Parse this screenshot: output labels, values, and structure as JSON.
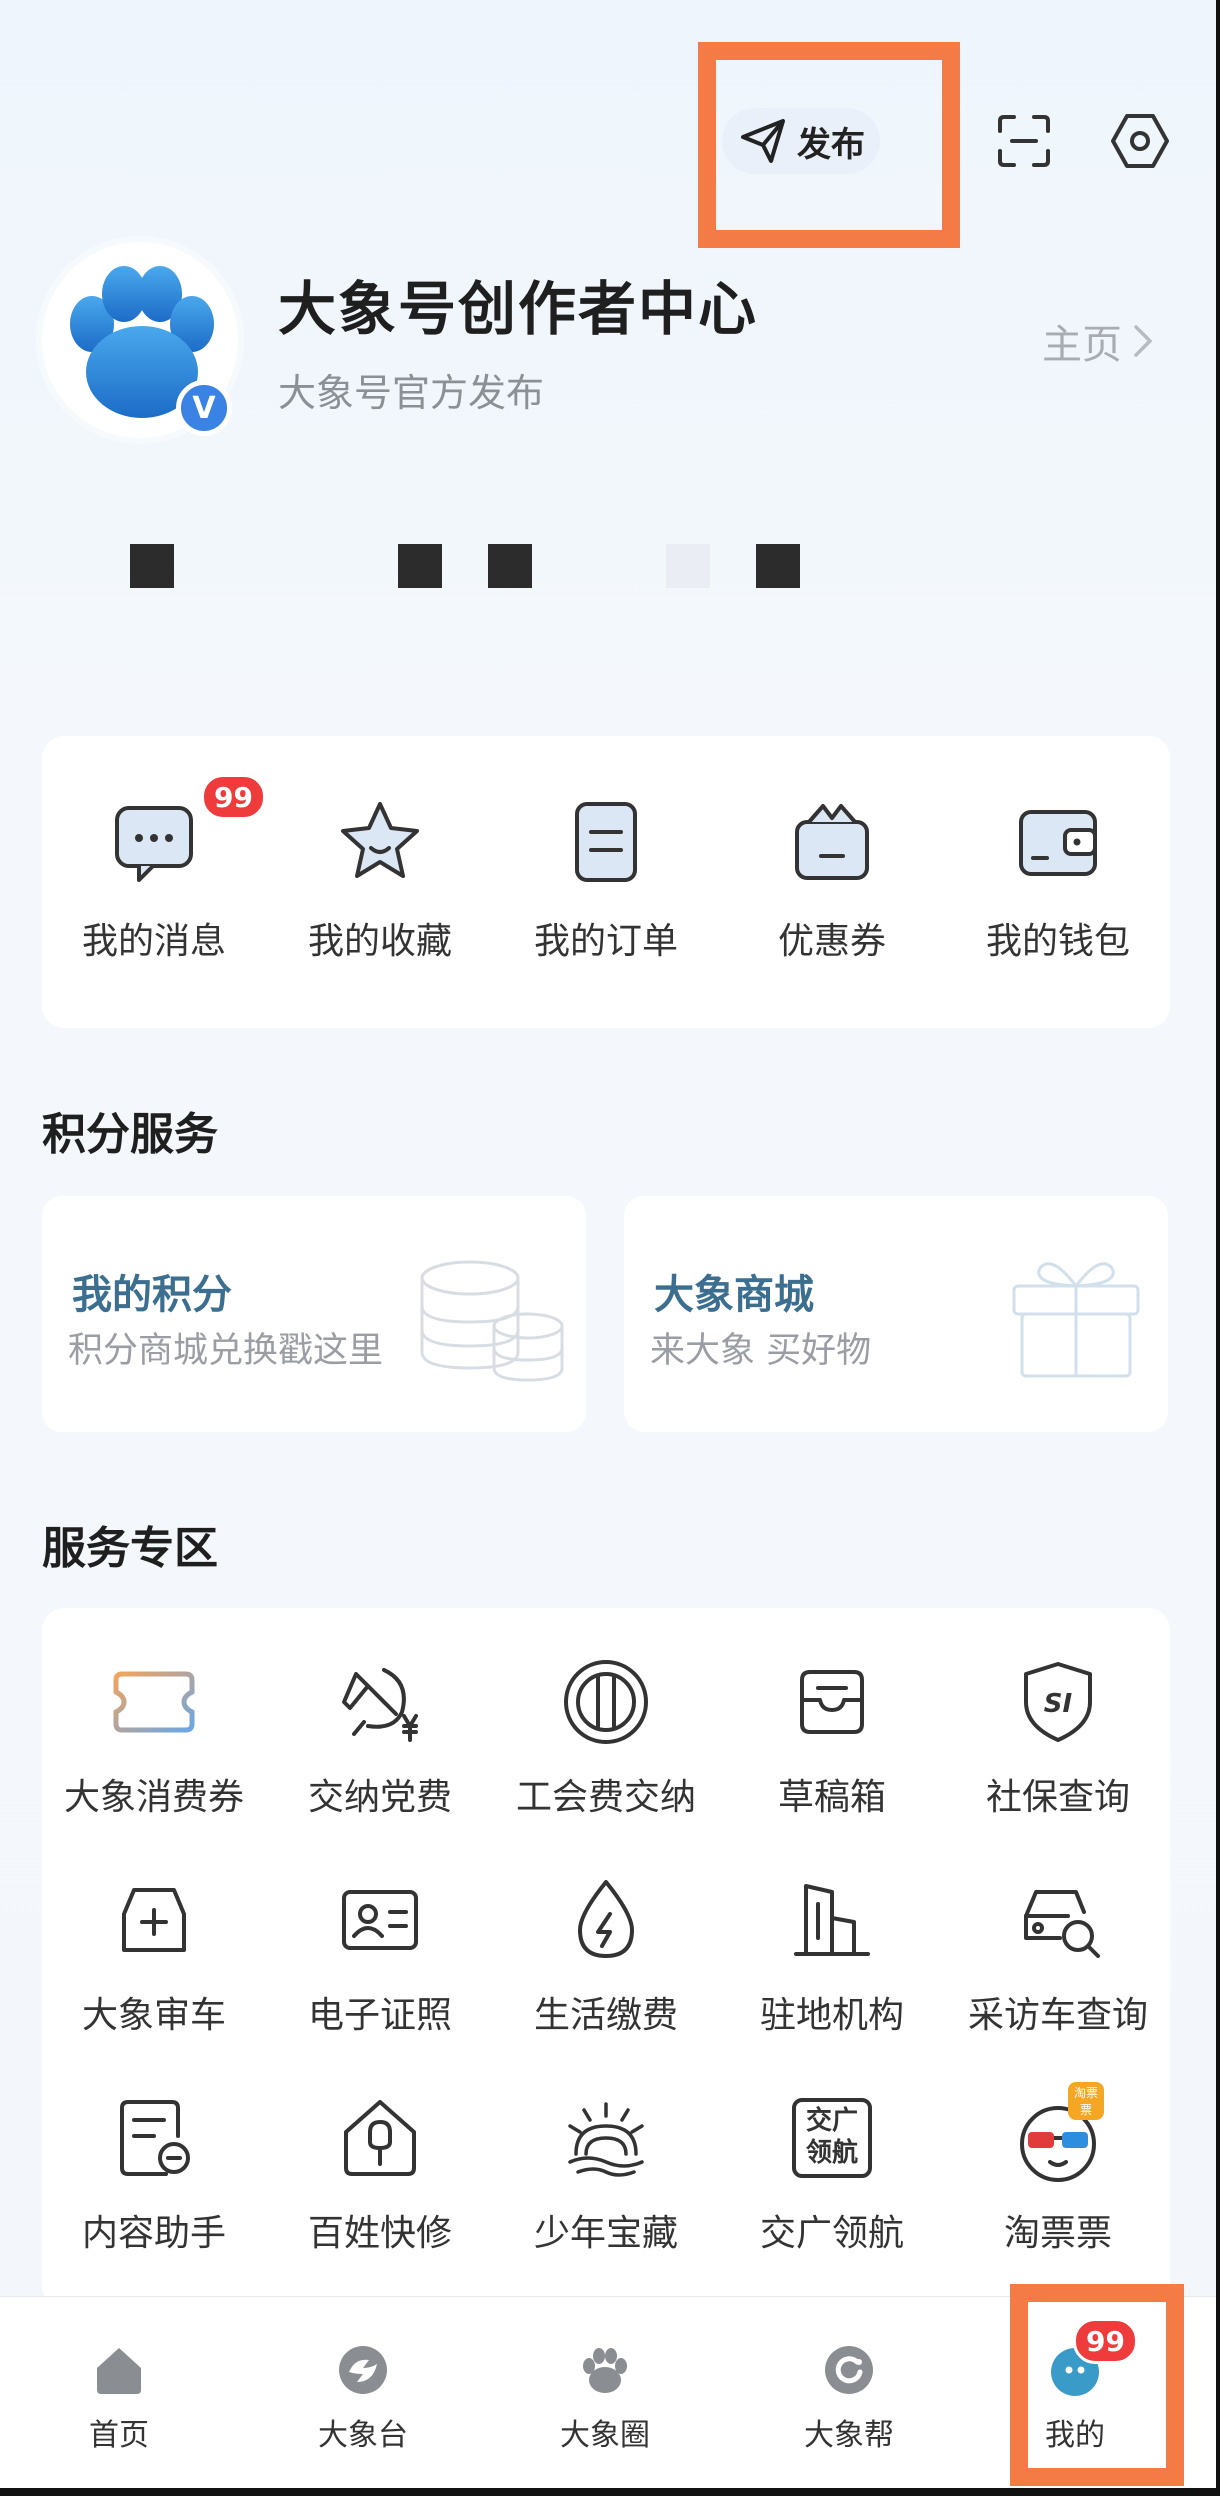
{
  "header": {
    "publish_label": "发布",
    "scan_icon": "scan-icon",
    "settings_icon": "settings-icon"
  },
  "profile": {
    "name": "大象号创作者中心",
    "subtitle": "大象号官方发布",
    "homepage_label": "主页",
    "verified_badge": "V"
  },
  "quick_actions": [
    {
      "label": "我的消息",
      "icon": "message-icon",
      "badge": "99"
    },
    {
      "label": "我的收藏",
      "icon": "star-icon"
    },
    {
      "label": "我的订单",
      "icon": "order-icon"
    },
    {
      "label": "优惠券",
      "icon": "coupon-icon"
    },
    {
      "label": "我的钱包",
      "icon": "wallet-icon"
    }
  ],
  "points_section": {
    "title": "积分服务",
    "cards": [
      {
        "title": "我的积分",
        "subtitle": "积分商城兑换戳这里",
        "icon": "coins-icon"
      },
      {
        "title": "大象商城",
        "subtitle": "来大象  买好物",
        "icon": "gift-icon"
      }
    ]
  },
  "services_section": {
    "title": "服务专区",
    "items": [
      {
        "label": "大象消费券",
        "icon": "ticket-icon"
      },
      {
        "label": "交纳党费",
        "icon": "party-fee-icon"
      },
      {
        "label": "工会费交纳",
        "icon": "union-icon"
      },
      {
        "label": "草稿箱",
        "icon": "draft-box-icon"
      },
      {
        "label": "社保查询",
        "icon": "social-security-icon"
      },
      {
        "label": "大象审车",
        "icon": "car-inspection-icon"
      },
      {
        "label": "电子证照",
        "icon": "id-card-icon"
      },
      {
        "label": "生活缴费",
        "icon": "utility-bill-icon"
      },
      {
        "label": "驻地机构",
        "icon": "building-icon"
      },
      {
        "label": "采访车查询",
        "icon": "car-search-icon"
      },
      {
        "label": "内容助手",
        "icon": "content-assistant-icon"
      },
      {
        "label": "百姓快修",
        "icon": "repair-icon"
      },
      {
        "label": "少年宝藏",
        "icon": "youth-treasure-icon"
      },
      {
        "label": "交广领航",
        "icon": "jiaoguang-icon"
      },
      {
        "label": "淘票票",
        "icon": "taopiaopiao-icon"
      }
    ],
    "jiaoguang_icon_text": [
      "交广",
      "领航"
    ],
    "taopiaopiao_tag": "淘票票"
  },
  "tabbar": {
    "tabs": [
      {
        "label": "首页",
        "icon": "home-icon"
      },
      {
        "label": "大象台",
        "icon": "elephant-tv-icon"
      },
      {
        "label": "大象圈",
        "icon": "paw-icon"
      },
      {
        "label": "大象帮",
        "icon": "help-icon"
      },
      {
        "label": "我的",
        "icon": "profile-icon",
        "badge": "99"
      }
    ]
  },
  "colors": {
    "accent_highlight": "#f47b45",
    "badge_red": "#ef3b3b",
    "points_title": "#3b6e8f",
    "brand_blue": "#2f86d8"
  }
}
